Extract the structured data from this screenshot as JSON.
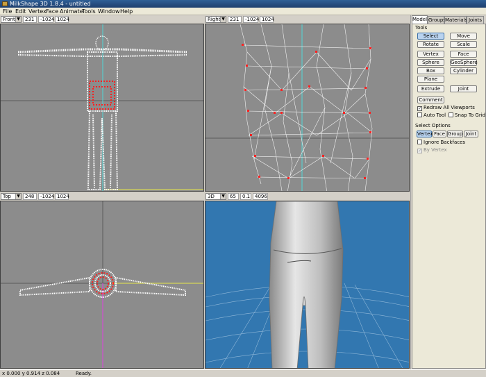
{
  "window": {
    "title": "MilkShape 3D 1.8.4 - untitled"
  },
  "menu": [
    "File",
    "Edit",
    "Vertex",
    "Face",
    "Animate",
    "Tools",
    "Window",
    "Help"
  ],
  "viewports": {
    "front": {
      "view": "Front",
      "fields": [
        "231",
        "-1024",
        "1024"
      ]
    },
    "right": {
      "view": "Right",
      "fields": [
        "231",
        "-1024",
        "1024"
      ]
    },
    "top": {
      "view": "Top",
      "fields": [
        "248",
        "-1024",
        "1024"
      ]
    },
    "three_d": {
      "view": "3D",
      "fields": [
        "65",
        "0.1",
        "4096"
      ]
    }
  },
  "panel": {
    "tabs": [
      "Model",
      "Groups",
      "Materials",
      "Joints"
    ],
    "active_tab": "Model",
    "tools_label": "Tools",
    "tools": [
      "Select",
      "Move",
      "Rotate",
      "Scale",
      "Vertex",
      "Face",
      "Sphere",
      "GeoSphere",
      "Box",
      "Cylinder",
      "Plane",
      "Extrude",
      "Joint"
    ],
    "active_tool": "Select",
    "comment_label": "Comment",
    "checks": {
      "redraw": {
        "label": "Redraw All Viewports",
        "checked": true
      },
      "auto_tool": {
        "label": "Auto Tool",
        "checked": false
      },
      "snap": {
        "label": "Snap To Grid",
        "checked": false
      }
    },
    "select_options_label": "Select Options",
    "select_modes": [
      "Vertex",
      "Face",
      "Group",
      "Joint"
    ],
    "active_select_mode": "Vertex",
    "ignore_backfaces": {
      "label": "Ignore Backfaces",
      "checked": false
    },
    "by_vertex": {
      "label": "By Vertex",
      "checked": true,
      "disabled": true
    }
  },
  "status": {
    "coords": "x 0.000 y 0.914 z 0.084",
    "state": "Ready."
  },
  "colors": {
    "viewport_gray": "#8c8c8c",
    "viewport_blue": "#3277b0",
    "selected_vertex": "#ff2020",
    "axis_cyan": "#3fe0e0",
    "axis_yellow": "#e8e84a",
    "axis_magenta": "#e040e0"
  }
}
